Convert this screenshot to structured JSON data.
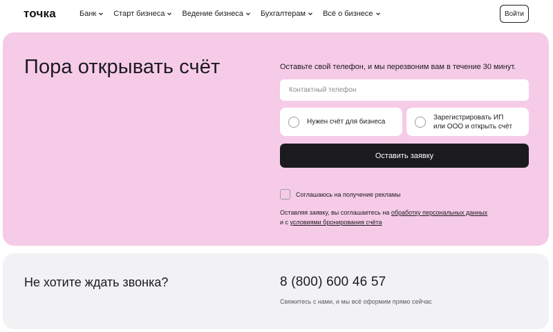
{
  "header": {
    "logo": "точка",
    "nav": [
      {
        "label": "Банк"
      },
      {
        "label": "Старт бизнеса"
      },
      {
        "label": "Ведение бизнеса"
      },
      {
        "label": "Бухгалтерам"
      },
      {
        "label": "Всё о бизнесе"
      }
    ],
    "login_label": "Войти"
  },
  "hero": {
    "title": "Пора открывать счёт",
    "form_hint": "Оставьте свой телефон, и мы перезвоним вам в течение 30 минут.",
    "phone_placeholder": "Контактный телефон",
    "options": [
      {
        "label": "Нужен счёт для бизнеса"
      },
      {
        "label_line1": "Зарегистрировать ИП",
        "label_line2": "или ООО и открыть счёт"
      }
    ],
    "submit_label": "Оставить заявку",
    "consent_label": "Соглашаюсь на получение рекламы",
    "legal": {
      "line1_prefix": "Оставляя заявку, вы соглашаетесь на ",
      "link1": "обработку персональных данных",
      "line2_prefix": "и с ",
      "link2": "условиями бронирования счёта"
    }
  },
  "callback": {
    "title": "Не хотите ждать звонка?",
    "phone": "8 (800) 600 46 57",
    "subtitle": "Свяжитесь с нами, и мы всё оформим прямо сейчас"
  },
  "colors": {
    "pink": "#f6cbe7",
    "grey": "#f2f1f4",
    "dark": "#1b1a1f"
  }
}
